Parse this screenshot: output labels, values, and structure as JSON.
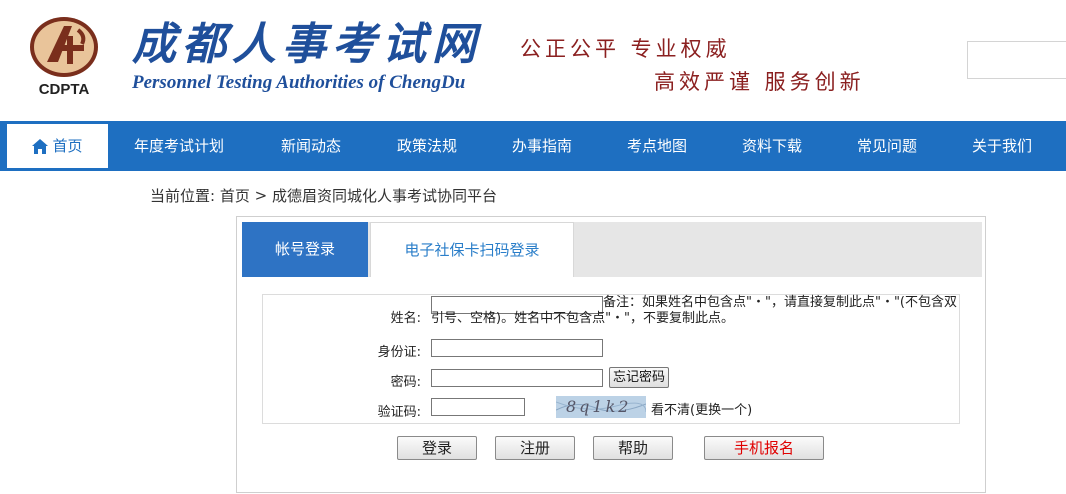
{
  "header": {
    "logo_text": "CDPTA",
    "title": "成都人事考试网",
    "subtitle": "Personnel Testing Authorities of ChengDu",
    "slogan_line1": "公正公平  专业权威",
    "slogan_line2": "高效严谨  服务创新",
    "search_placeholder": ""
  },
  "nav": {
    "items": [
      {
        "label": "首页",
        "active": true
      },
      {
        "label": "年度考试计划"
      },
      {
        "label": "新闻动态"
      },
      {
        "label": "政策法规"
      },
      {
        "label": "办事指南"
      },
      {
        "label": "考点地图"
      },
      {
        "label": "资料下载"
      },
      {
        "label": "常见问题"
      },
      {
        "label": "关于我们"
      }
    ]
  },
  "breadcrumb": {
    "prefix": "当前位置:",
    "home": "首页",
    "separator": ">",
    "current": "成德眉资同城化人事考试协同平台"
  },
  "login": {
    "tabs": [
      {
        "label": "帐号登录",
        "active": true
      },
      {
        "label": "电子社保卡扫码登录"
      }
    ],
    "fields": {
      "name_label": "姓名:",
      "name_value": "",
      "name_note": "备注：如果姓名中包含点\"・\"，请直接复制此点\"・\"(不包含双引号、空格)。姓名中不包含点\"・\"，不要复制此点。",
      "id_label": "身份证:",
      "id_value": "",
      "password_label": "密码:",
      "password_value": "",
      "forgot_label": "忘记密码",
      "captcha_label": "验证码:",
      "captcha_value": "",
      "captcha_image_text": "8q1k2",
      "captcha_refresh": "看不清(更换一个)"
    },
    "buttons": {
      "login": "登录",
      "register": "注册",
      "help": "帮助",
      "mobile": "手机报名"
    }
  },
  "colors": {
    "nav_bg": "#1e6fc1",
    "brand_blue": "#1f4f9b",
    "slogan_red": "#8b2020",
    "mobile_btn_text": "#e00000"
  }
}
